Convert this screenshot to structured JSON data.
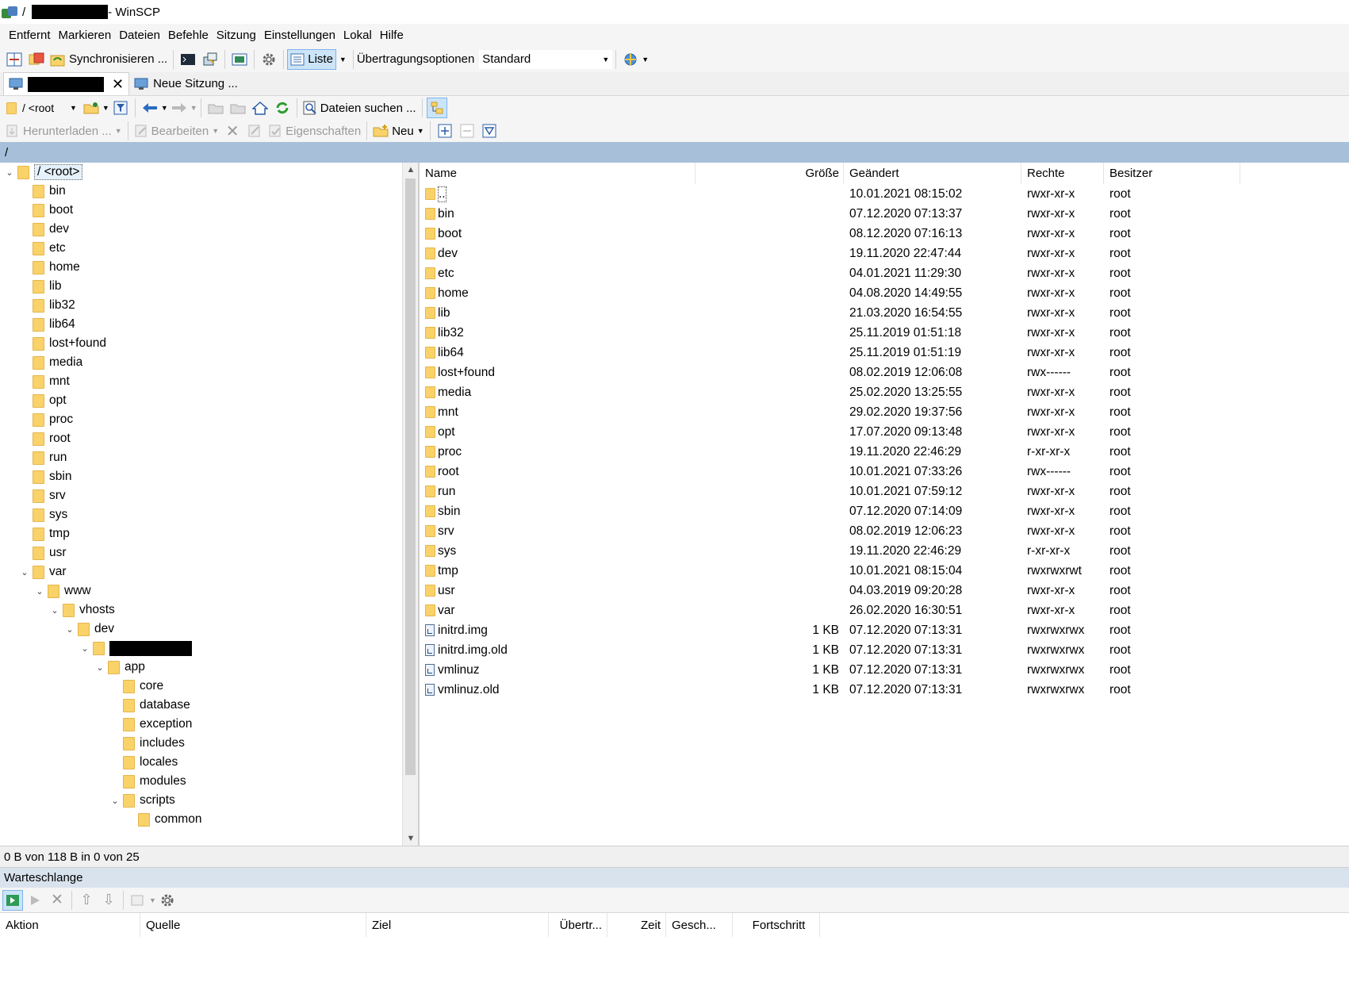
{
  "window": {
    "title_prefix": "/",
    "title_app": "- WinSCP"
  },
  "menu": [
    "Entfernt",
    "Markieren",
    "Dateien",
    "Befehle",
    "Sitzung",
    "Einstellungen",
    "Lokal",
    "Hilfe"
  ],
  "toolbar": {
    "sync_label": "Synchronisieren ...",
    "view_label": "Liste",
    "transfer_label": "Übertragungsoptionen",
    "transfer_value": "Standard"
  },
  "tabs": {
    "new_session_label": "Neue Sitzung ..."
  },
  "nav": {
    "path_value": "/ <root",
    "find_label": "Dateien suchen ..."
  },
  "actions": {
    "download_label": "Herunterladen ...",
    "edit_label": "Bearbeiten",
    "properties_label": "Eigenschaften",
    "new_label": "Neu"
  },
  "path": "/",
  "tree": [
    {
      "label": "/ <root>",
      "depth": 0,
      "tog": "v"
    },
    {
      "label": "bin",
      "depth": 1
    },
    {
      "label": "boot",
      "depth": 1
    },
    {
      "label": "dev",
      "depth": 1
    },
    {
      "label": "etc",
      "depth": 1
    },
    {
      "label": "home",
      "depth": 1
    },
    {
      "label": "lib",
      "depth": 1
    },
    {
      "label": "lib32",
      "depth": 1
    },
    {
      "label": "lib64",
      "depth": 1
    },
    {
      "label": "lost+found",
      "depth": 1
    },
    {
      "label": "media",
      "depth": 1
    },
    {
      "label": "mnt",
      "depth": 1
    },
    {
      "label": "opt",
      "depth": 1
    },
    {
      "label": "proc",
      "depth": 1
    },
    {
      "label": "root",
      "depth": 1
    },
    {
      "label": "run",
      "depth": 1
    },
    {
      "label": "sbin",
      "depth": 1
    },
    {
      "label": "srv",
      "depth": 1
    },
    {
      "label": "sys",
      "depth": 1
    },
    {
      "label": "tmp",
      "depth": 1
    },
    {
      "label": "usr",
      "depth": 1
    },
    {
      "label": "var",
      "depth": 1,
      "tog": "v"
    },
    {
      "label": "www",
      "depth": 2,
      "tog": "v"
    },
    {
      "label": "vhosts",
      "depth": 3,
      "tog": "v"
    },
    {
      "label": "dev",
      "depth": 4,
      "tog": "v"
    },
    {
      "label": "",
      "depth": 5,
      "tog": "v",
      "redacted": true
    },
    {
      "label": "app",
      "depth": 6,
      "tog": "v"
    },
    {
      "label": "core",
      "depth": 7
    },
    {
      "label": "database",
      "depth": 7
    },
    {
      "label": "exception",
      "depth": 7
    },
    {
      "label": "includes",
      "depth": 7
    },
    {
      "label": "locales",
      "depth": 7
    },
    {
      "label": "modules",
      "depth": 7
    },
    {
      "label": "scripts",
      "depth": 7,
      "tog": "v"
    },
    {
      "label": "common",
      "depth": 8
    }
  ],
  "columns": {
    "name": "Name",
    "size": "Größe",
    "modified": "Geändert",
    "rights": "Rechte",
    "owner": "Besitzer"
  },
  "files": [
    {
      "name": "..",
      "size": "",
      "modified": "10.01.2021 08:15:02",
      "rights": "rwxr-xr-x",
      "owner": "root",
      "type": "up"
    },
    {
      "name": "bin",
      "size": "",
      "modified": "07.12.2020 07:13:37",
      "rights": "rwxr-xr-x",
      "owner": "root",
      "type": "dir"
    },
    {
      "name": "boot",
      "size": "",
      "modified": "08.12.2020 07:16:13",
      "rights": "rwxr-xr-x",
      "owner": "root",
      "type": "dir"
    },
    {
      "name": "dev",
      "size": "",
      "modified": "19.11.2020 22:47:44",
      "rights": "rwxr-xr-x",
      "owner": "root",
      "type": "dir"
    },
    {
      "name": "etc",
      "size": "",
      "modified": "04.01.2021 11:29:30",
      "rights": "rwxr-xr-x",
      "owner": "root",
      "type": "dir"
    },
    {
      "name": "home",
      "size": "",
      "modified": "04.08.2020 14:49:55",
      "rights": "rwxr-xr-x",
      "owner": "root",
      "type": "dir"
    },
    {
      "name": "lib",
      "size": "",
      "modified": "21.03.2020 16:54:55",
      "rights": "rwxr-xr-x",
      "owner": "root",
      "type": "dir"
    },
    {
      "name": "lib32",
      "size": "",
      "modified": "25.11.2019 01:51:18",
      "rights": "rwxr-xr-x",
      "owner": "root",
      "type": "dir"
    },
    {
      "name": "lib64",
      "size": "",
      "modified": "25.11.2019 01:51:19",
      "rights": "rwxr-xr-x",
      "owner": "root",
      "type": "dir"
    },
    {
      "name": "lost+found",
      "size": "",
      "modified": "08.02.2019 12:06:08",
      "rights": "rwx------",
      "owner": "root",
      "type": "dir"
    },
    {
      "name": "media",
      "size": "",
      "modified": "25.02.2020 13:25:55",
      "rights": "rwxr-xr-x",
      "owner": "root",
      "type": "dir"
    },
    {
      "name": "mnt",
      "size": "",
      "modified": "29.02.2020 19:37:56",
      "rights": "rwxr-xr-x",
      "owner": "root",
      "type": "dir"
    },
    {
      "name": "opt",
      "size": "",
      "modified": "17.07.2020 09:13:48",
      "rights": "rwxr-xr-x",
      "owner": "root",
      "type": "dir"
    },
    {
      "name": "proc",
      "size": "",
      "modified": "19.11.2020 22:46:29",
      "rights": "r-xr-xr-x",
      "owner": "root",
      "type": "dir"
    },
    {
      "name": "root",
      "size": "",
      "modified": "10.01.2021 07:33:26",
      "rights": "rwx------",
      "owner": "root",
      "type": "dir"
    },
    {
      "name": "run",
      "size": "",
      "modified": "10.01.2021 07:59:12",
      "rights": "rwxr-xr-x",
      "owner": "root",
      "type": "dir"
    },
    {
      "name": "sbin",
      "size": "",
      "modified": "07.12.2020 07:14:09",
      "rights": "rwxr-xr-x",
      "owner": "root",
      "type": "dir"
    },
    {
      "name": "srv",
      "size": "",
      "modified": "08.02.2019 12:06:23",
      "rights": "rwxr-xr-x",
      "owner": "root",
      "type": "dir"
    },
    {
      "name": "sys",
      "size": "",
      "modified": "19.11.2020 22:46:29",
      "rights": "r-xr-xr-x",
      "owner": "root",
      "type": "dir"
    },
    {
      "name": "tmp",
      "size": "",
      "modified": "10.01.2021 08:15:04",
      "rights": "rwxrwxrwt",
      "owner": "root",
      "type": "dir"
    },
    {
      "name": "usr",
      "size": "",
      "modified": "04.03.2019 09:20:28",
      "rights": "rwxr-xr-x",
      "owner": "root",
      "type": "dir"
    },
    {
      "name": "var",
      "size": "",
      "modified": "26.02.2020 16:30:51",
      "rights": "rwxr-xr-x",
      "owner": "root",
      "type": "dir"
    },
    {
      "name": "initrd.img",
      "size": "1 KB",
      "modified": "07.12.2020 07:13:31",
      "rights": "rwxrwxrwx",
      "owner": "root",
      "type": "link"
    },
    {
      "name": "initrd.img.old",
      "size": "1 KB",
      "modified": "07.12.2020 07:13:31",
      "rights": "rwxrwxrwx",
      "owner": "root",
      "type": "link"
    },
    {
      "name": "vmlinuz",
      "size": "1 KB",
      "modified": "07.12.2020 07:13:31",
      "rights": "rwxrwxrwx",
      "owner": "root",
      "type": "link"
    },
    {
      "name": "vmlinuz.old",
      "size": "1 KB",
      "modified": "07.12.2020 07:13:31",
      "rights": "rwxrwxrwx",
      "owner": "root",
      "type": "link"
    }
  ],
  "status": "0 B von 118 B in 0 von 25",
  "queue": {
    "title": "Warteschlange",
    "columns": [
      "Aktion",
      "Quelle",
      "Ziel",
      "Übertr...",
      "Zeit",
      "Gesch...",
      "Fortschritt"
    ]
  },
  "colors": {
    "path_bar": "#a7bfd8",
    "queue_header": "#d9e3ee",
    "folder": "#f9d26a"
  }
}
